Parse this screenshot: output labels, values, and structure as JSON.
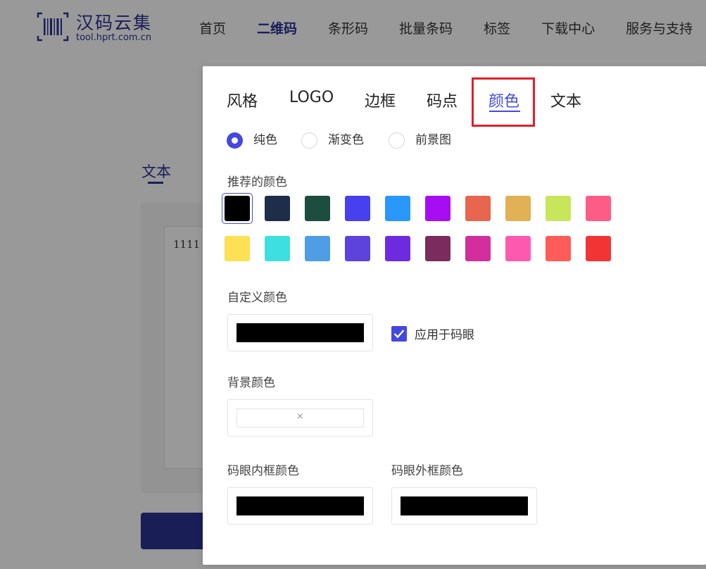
{
  "header": {
    "logo_title": "汉码云集",
    "logo_subtitle": "tool.hprt.com.cn",
    "nav": [
      {
        "label": "首页",
        "active": false
      },
      {
        "label": "二维码",
        "active": true
      },
      {
        "label": "条形码",
        "active": false
      },
      {
        "label": "批量条码",
        "active": false
      },
      {
        "label": "标签",
        "active": false
      },
      {
        "label": "下载中心",
        "active": false
      },
      {
        "label": "服务与支持",
        "active": false
      }
    ]
  },
  "background_page": {
    "active_tab": "文本",
    "text_value": "1111"
  },
  "modal": {
    "tabs": [
      {
        "label": "风格",
        "active": false
      },
      {
        "label": "LOGO",
        "active": false
      },
      {
        "label": "边框",
        "active": false
      },
      {
        "label": "码点",
        "active": false
      },
      {
        "label": "颜色",
        "active": true
      },
      {
        "label": "文本",
        "active": false
      }
    ],
    "color_modes": [
      {
        "label": "纯色",
        "checked": true
      },
      {
        "label": "渐变色",
        "checked": false
      },
      {
        "label": "前景图",
        "checked": false
      }
    ],
    "recommended_label": "推荐的颜色",
    "swatches_row1": [
      "#000000",
      "#1e2d4a",
      "#1c4d3e",
      "#4640ee",
      "#2997fb",
      "#a70df2",
      "#e8654e",
      "#e2b155",
      "#c9e55a",
      "#fd5c87"
    ],
    "swatches_row2": [
      "#fde053",
      "#3ddfe0",
      "#4f9de4",
      "#5d43db",
      "#6e2ae1",
      "#7b2b5e",
      "#d22f9d",
      "#fd5aaf",
      "#fd5c59",
      "#f23434"
    ],
    "selected_swatch": "#000000",
    "custom_color_label": "自定义颜色",
    "custom_color_value": "#000000",
    "apply_to_eye_label": "应用于码眼",
    "apply_to_eye_checked": true,
    "background_color_label": "背景颜色",
    "background_color_empty_symbol": "×",
    "eye_inner_label": "码眼内框颜色",
    "eye_inner_value": "#000000",
    "eye_outer_label": "码眼外框颜色",
    "eye_outer_value": "#000000",
    "accent_color": "#4548e0",
    "highlight_color": "#e0202a"
  }
}
